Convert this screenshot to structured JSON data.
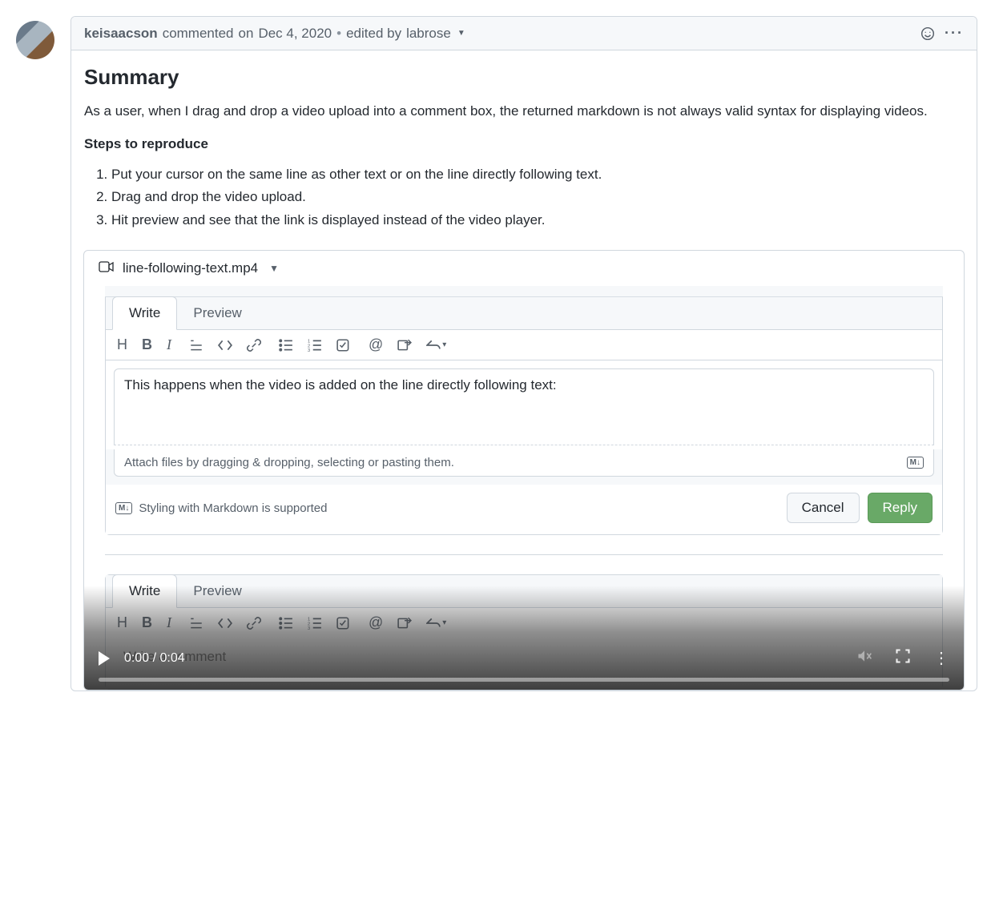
{
  "header": {
    "author": "keisaacson",
    "commented": "commented",
    "date_prefix": "on",
    "date": "Dec 4, 2020",
    "edited_prefix": "edited by",
    "editor": "labrose"
  },
  "body": {
    "heading": "Summary",
    "paragraph": "As a user, when I drag and drop a video upload into a comment box, the returned markdown is not always valid syntax for displaying videos.",
    "steps_title": "Steps to reproduce",
    "steps": [
      "Put your cursor on the same line as other text or on the line directly following text.",
      "Drag and drop the video upload.",
      "Hit preview and see that the link is displayed instead of the video player."
    ]
  },
  "attachment": {
    "filename": "line-following-text.mp4"
  },
  "editor1": {
    "tabs": {
      "write": "Write",
      "preview": "Preview"
    },
    "textarea_value": "This happens when the video is added on the line directly following text:",
    "attach_hint": "Attach files by dragging & dropping, selecting or pasting them.",
    "md_help": "Styling with Markdown is supported",
    "cancel": "Cancel",
    "reply": "Reply"
  },
  "editor2": {
    "tabs": {
      "write": "Write",
      "preview": "Preview"
    },
    "placeholder": "Write a comment"
  },
  "video": {
    "time": "0:00 / 0:04"
  },
  "md_badge": "M↓"
}
